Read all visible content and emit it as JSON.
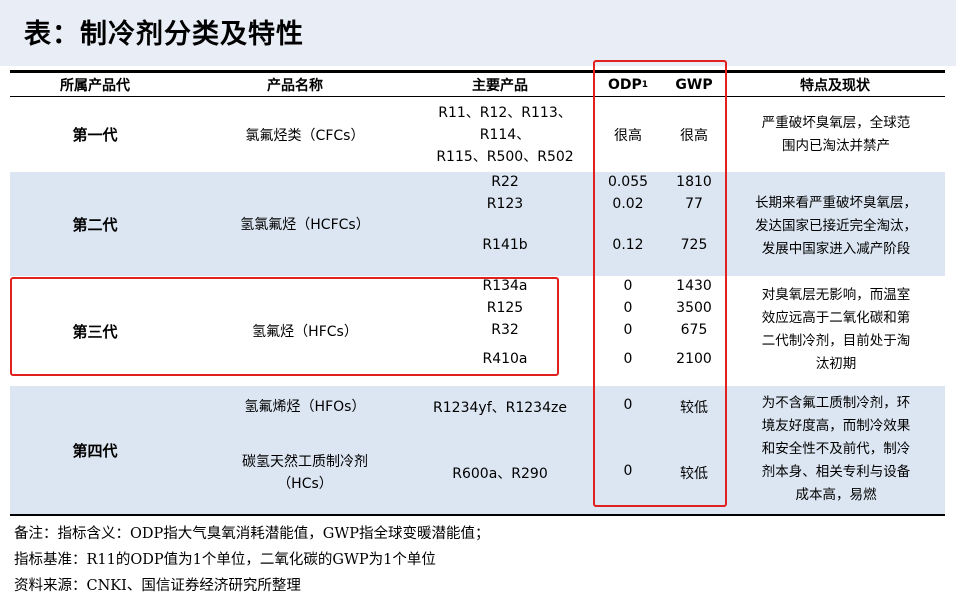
{
  "title": "表：制冷剂分类及特性",
  "headers": {
    "gen": "所属产品代",
    "name": "产品名称",
    "products": "主要产品",
    "odp": "ODP",
    "odp_sup": "1",
    "gwp": "GWP",
    "features": "特点及现状"
  },
  "rows": [
    {
      "gen": "第一代",
      "name": "氯氟烃类（CFCs）",
      "products": [
        "R11、R12、R113、",
        "R114、",
        "R115、R500、R502"
      ],
      "odp": "很高",
      "gwp": "很高",
      "features": [
        "严重破坏臭氧层，全球范",
        "围内已淘汰并禁产"
      ]
    },
    {
      "gen": "第二代",
      "name": "氢氯氟烃（HCFCs）",
      "products": [
        "R22",
        "R123",
        "R141b"
      ],
      "odp": [
        "0.055",
        "0.02",
        "0.12"
      ],
      "gwp": [
        "1810",
        "77",
        "725"
      ],
      "features": [
        "长期来看严重破坏臭氧层，",
        "发达国家已接近完全淘汰，",
        "发展中国家进入减产阶段"
      ]
    },
    {
      "gen": "第三代",
      "name": "氢氟烃（HFCs）",
      "products": [
        "R134a",
        "R125",
        "R32",
        "R410a"
      ],
      "odp": [
        "0",
        "0",
        "0",
        "0"
      ],
      "gwp": [
        "1430",
        "3500",
        "675",
        "2100"
      ],
      "features": [
        "对臭氧层无影响，而温室",
        "效应远高于二氧化碳和第",
        "二代制冷剂，目前处于淘",
        "汰初期"
      ]
    },
    {
      "gen": "第四代",
      "subrows": [
        {
          "name": "氢氟烯烃（HFOs）",
          "products": "R1234yf、R1234ze",
          "odp": "0",
          "gwp": "较低"
        },
        {
          "name": [
            "碳氢天然工质制冷剂",
            "（HCs）"
          ],
          "products": "R600a、R290",
          "odp": "0",
          "gwp": "较低"
        }
      ],
      "features": [
        "为不含氟工质制冷剂，环",
        "境友好度高，而制冷效果",
        "和安全性不及前代，制冷",
        "剂本身、相关专利与设备",
        "成本高，易燃"
      ]
    }
  ],
  "notes": [
    "备注：指标含义：ODP指大气臭氧消耗潜能值，GWP指全球变暖潜能值；",
    "指标基准：R11的ODP值为1个单位，二氧化碳的GWP为1个单位",
    "资料来源：CNKI、国信证券经济研究所整理"
  ],
  "colors": {
    "title_band": "#e9edf6",
    "row_band": "#dce6f2",
    "highlight_box": "#e0211d"
  }
}
